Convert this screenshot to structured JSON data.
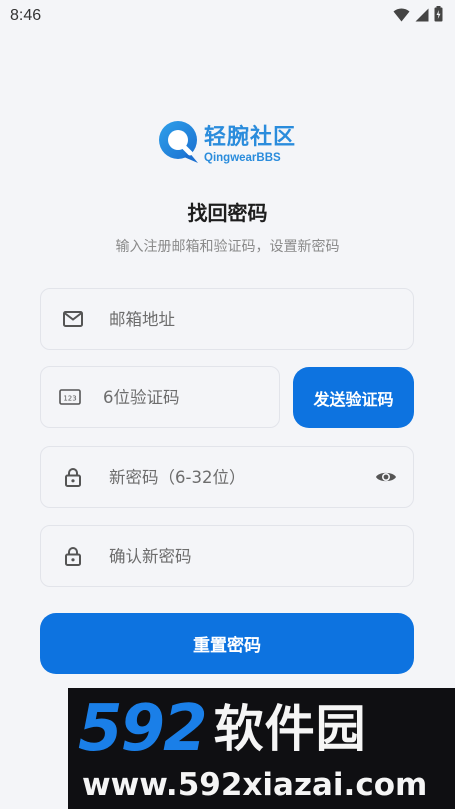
{
  "status_bar": {
    "time": "8:46",
    "icons": [
      "wifi-icon",
      "signal-icon",
      "battery-icon"
    ]
  },
  "logo": {
    "name_cn": "轻腕社区",
    "name_en": "QingwearBBS"
  },
  "page": {
    "title": "找回密码",
    "subtitle": "输入注册邮箱和验证码，设置新密码"
  },
  "form": {
    "email": {
      "placeholder": "邮箱地址",
      "value": "",
      "icon": "mail-icon"
    },
    "code": {
      "placeholder": "6位验证码",
      "value": "",
      "icon": "code-123-icon"
    },
    "send_code_label": "发送验证码",
    "new_password": {
      "placeholder": "新密码（6-32位）",
      "value": "",
      "icon": "lock-icon"
    },
    "confirm_password": {
      "placeholder": "确认新密码",
      "value": "",
      "icon": "lock-icon"
    },
    "reset_label": "重置密码"
  },
  "watermark": {
    "number": "592",
    "name_cn": "软件园",
    "url": "www.592xiazai.com"
  },
  "colors": {
    "primary": "#0d73e0",
    "logo": "#2a8cdc",
    "background": "#f4f5f8"
  }
}
